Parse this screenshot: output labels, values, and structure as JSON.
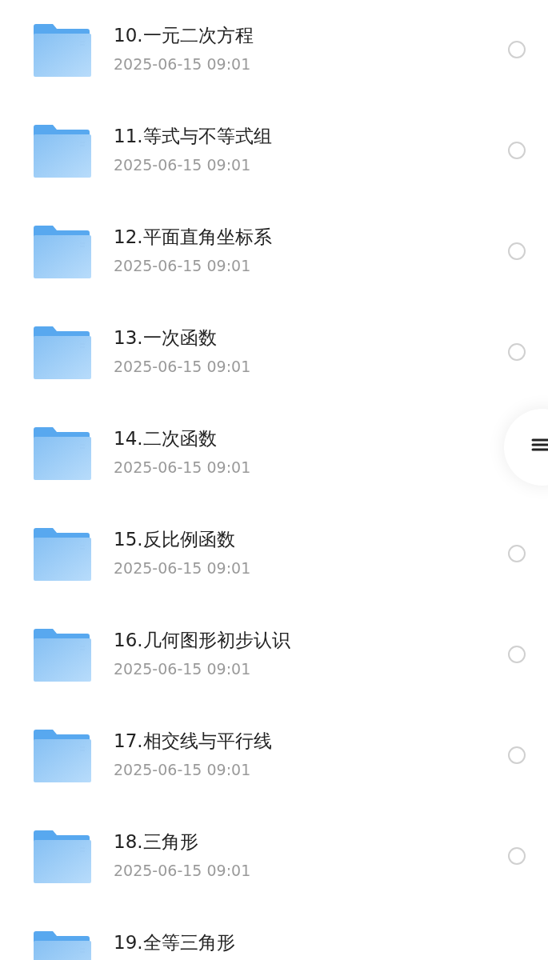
{
  "folders": [
    {
      "name": "10.一元二次方程",
      "date": "2025-06-15 09:01",
      "selected": false
    },
    {
      "name": "11.等式与不等式组",
      "date": "2025-06-15 09:01",
      "selected": false
    },
    {
      "name": "12.平面直角坐标系",
      "date": "2025-06-15 09:01",
      "selected": false
    },
    {
      "name": "13.一次函数",
      "date": "2025-06-15 09:01",
      "selected": false
    },
    {
      "name": "14.二次函数",
      "date": "2025-06-15 09:01"
    },
    {
      "name": "15.反比例函数",
      "date": "2025-06-15 09:01",
      "selected": false
    },
    {
      "name": "16.几何图形初步认识",
      "date": "2025-06-15 09:01",
      "selected": false
    },
    {
      "name": "17.相交线与平行线",
      "date": "2025-06-15 09:01",
      "selected": false
    },
    {
      "name": "18.三角形",
      "date": "2025-06-15 09:01",
      "selected": false
    },
    {
      "name": "19.全等三角形"
    }
  ]
}
